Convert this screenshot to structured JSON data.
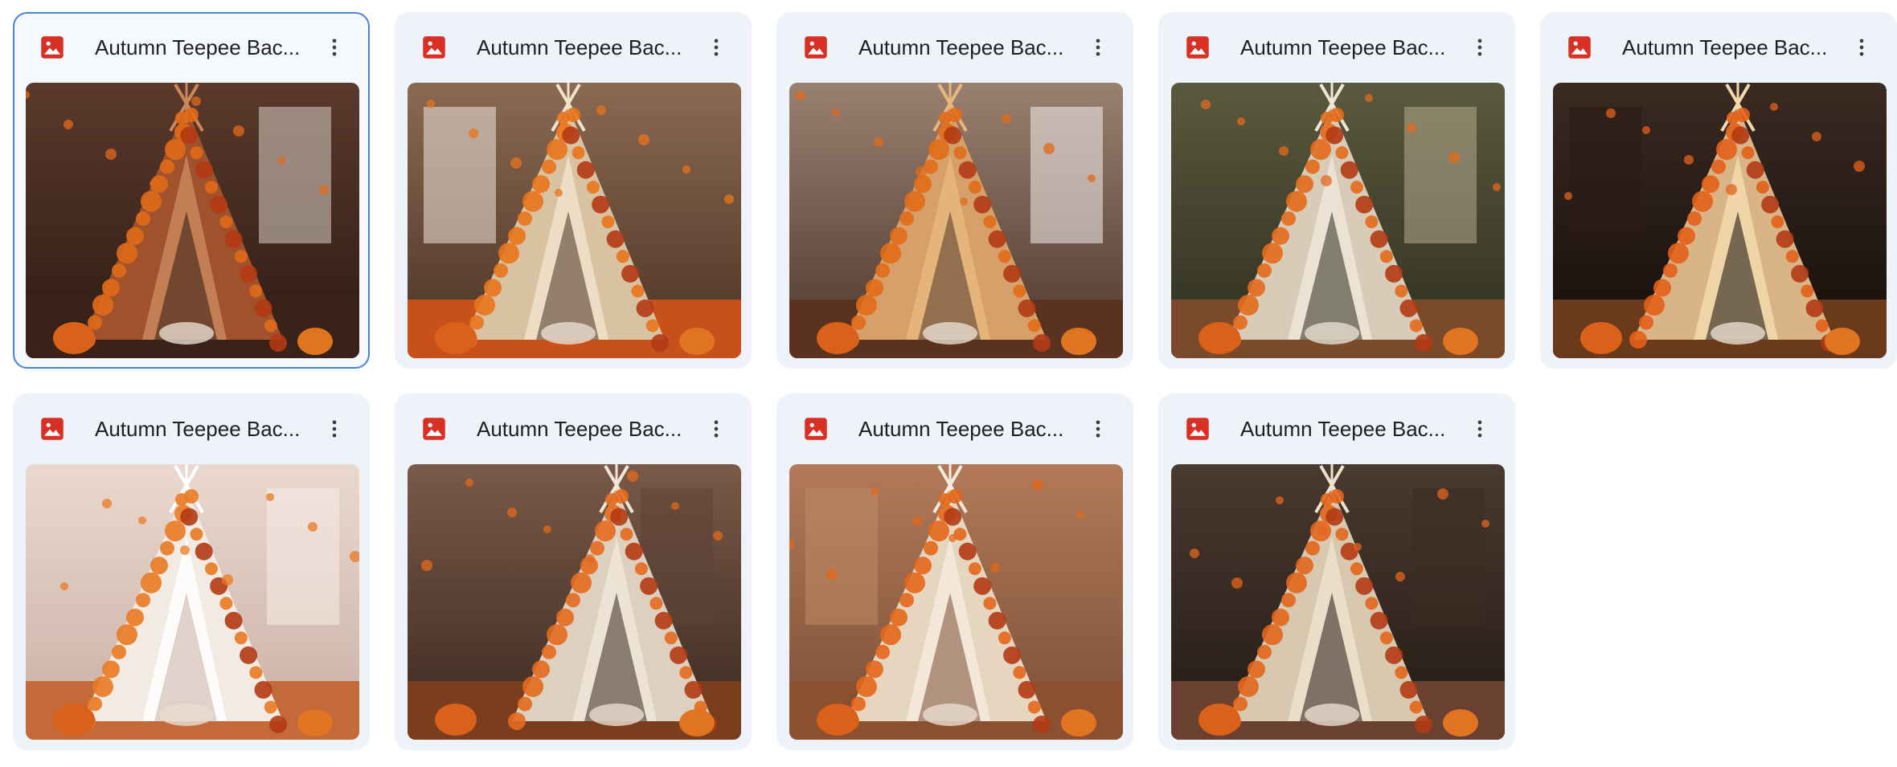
{
  "files": [
    {
      "name": "Autumn Teepee Bac...",
      "type": "image",
      "selected": true,
      "palette": {
        "bg": "#5b3a2c",
        "bg2": "#2d1a12",
        "tent": "#a0522d",
        "tentLight": "#c9875a",
        "floor": "#3a2218",
        "accent": "#e06a1a",
        "window": "#d8d0c6"
      }
    },
    {
      "name": "Autumn Teepee Bac...",
      "type": "image",
      "selected": false,
      "palette": {
        "bg": "#8b6a52",
        "bg2": "#4a3224",
        "tent": "#d9c2a2",
        "tentLight": "#f0e2cb",
        "floor": "#c8501a",
        "accent": "#e8741c",
        "window": "#efe6da"
      }
    },
    {
      "name": "Autumn Teepee Bac...",
      "type": "image",
      "selected": false,
      "palette": {
        "bg": "#9a8070",
        "bg2": "#4c372b",
        "tent": "#d7a06a",
        "tentLight": "#e8b77d",
        "floor": "#5a3320",
        "accent": "#e06b18",
        "window": "#f3f1ee"
      }
    },
    {
      "name": "Autumn Teepee Bac...",
      "type": "image",
      "selected": false,
      "palette": {
        "bg": "#5a5a3e",
        "bg2": "#2e2e1f",
        "tent": "#d8cbb8",
        "tentLight": "#efe6d7",
        "floor": "#7a4a2a",
        "accent": "#e46a1d",
        "window": "#b6a98e"
      }
    },
    {
      "name": "Autumn Teepee Bac...",
      "type": "image",
      "selected": false,
      "palette": {
        "bg": "#3a2a22",
        "bg2": "#140d09",
        "tent": "#d8b486",
        "tentLight": "#f2d9ad",
        "floor": "#6a3a1a",
        "accent": "#e3611a",
        "window": "#2a1c15"
      }
    },
    {
      "name": "Autumn Teepee Bac...",
      "type": "image",
      "selected": false,
      "palette": {
        "bg": "#ead9d0",
        "bg2": "#c9aea2",
        "tent": "#f2ebe4",
        "tentLight": "#ffffff",
        "floor": "#c46a3a",
        "accent": "#ea7a22",
        "window": "#f6ede8"
      }
    },
    {
      "name": "Autumn Teepee Bac...",
      "type": "image",
      "selected": false,
      "palette": {
        "bg": "#7a5a48",
        "bg2": "#3a2820",
        "tent": "#ddd0bf",
        "tentLight": "#f0e6d8",
        "floor": "#7a3e1e",
        "accent": "#e36a1e",
        "window": "#5c4436"
      }
    },
    {
      "name": "Autumn Teepee Bac...",
      "type": "image",
      "selected": false,
      "palette": {
        "bg": "#b27a5a",
        "bg2": "#7a4e36",
        "tent": "#e6d6c0",
        "tentLight": "#f5eadb",
        "floor": "#8a5030",
        "accent": "#e3671a",
        "window": "#c08a66"
      }
    },
    {
      "name": "Autumn Teepee Bac...",
      "type": "image",
      "selected": false,
      "palette": {
        "bg": "#4a3a30",
        "bg2": "#231a14",
        "tent": "#d8c8b0",
        "tentLight": "#efe2cc",
        "floor": "#6a4030",
        "accent": "#e2661c",
        "window": "#3a2d25"
      }
    }
  ],
  "colors": {
    "fileIcon": "#d93025",
    "moreIcon": "#3c3c3c",
    "cardBg": "#eef2f9",
    "selectedBorder": "#4a84d6"
  },
  "icons": {
    "file": "image-file-icon",
    "more": "more-vertical-icon"
  }
}
